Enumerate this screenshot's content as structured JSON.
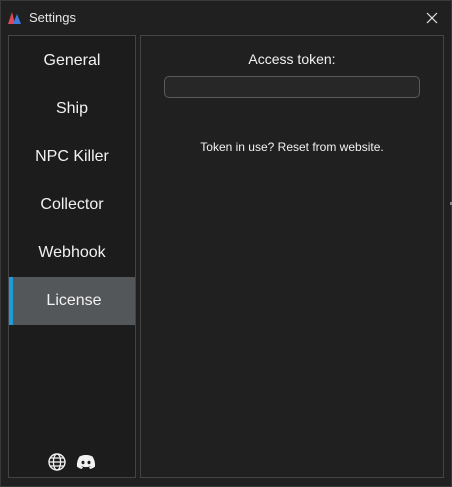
{
  "window": {
    "title": "Settings"
  },
  "sidebar": {
    "items": [
      {
        "label": "General",
        "active": false
      },
      {
        "label": "Ship",
        "active": false
      },
      {
        "label": "NPC Killer",
        "active": false
      },
      {
        "label": "Collector",
        "active": false
      },
      {
        "label": "Webhook",
        "active": false
      },
      {
        "label": "License",
        "active": true
      }
    ],
    "footer_icons": [
      "globe-icon",
      "discord-icon"
    ]
  },
  "license": {
    "token_label": "Access token:",
    "token_value": "",
    "token_placeholder": "",
    "reset_note": "Token in use? Reset from website."
  },
  "colors": {
    "background": "#202020",
    "sidebar_background": "#1c1c1c",
    "active_item": "#54575a",
    "accent": "#1e9bd9",
    "text": "#f2f2f2",
    "border": "#444444"
  }
}
